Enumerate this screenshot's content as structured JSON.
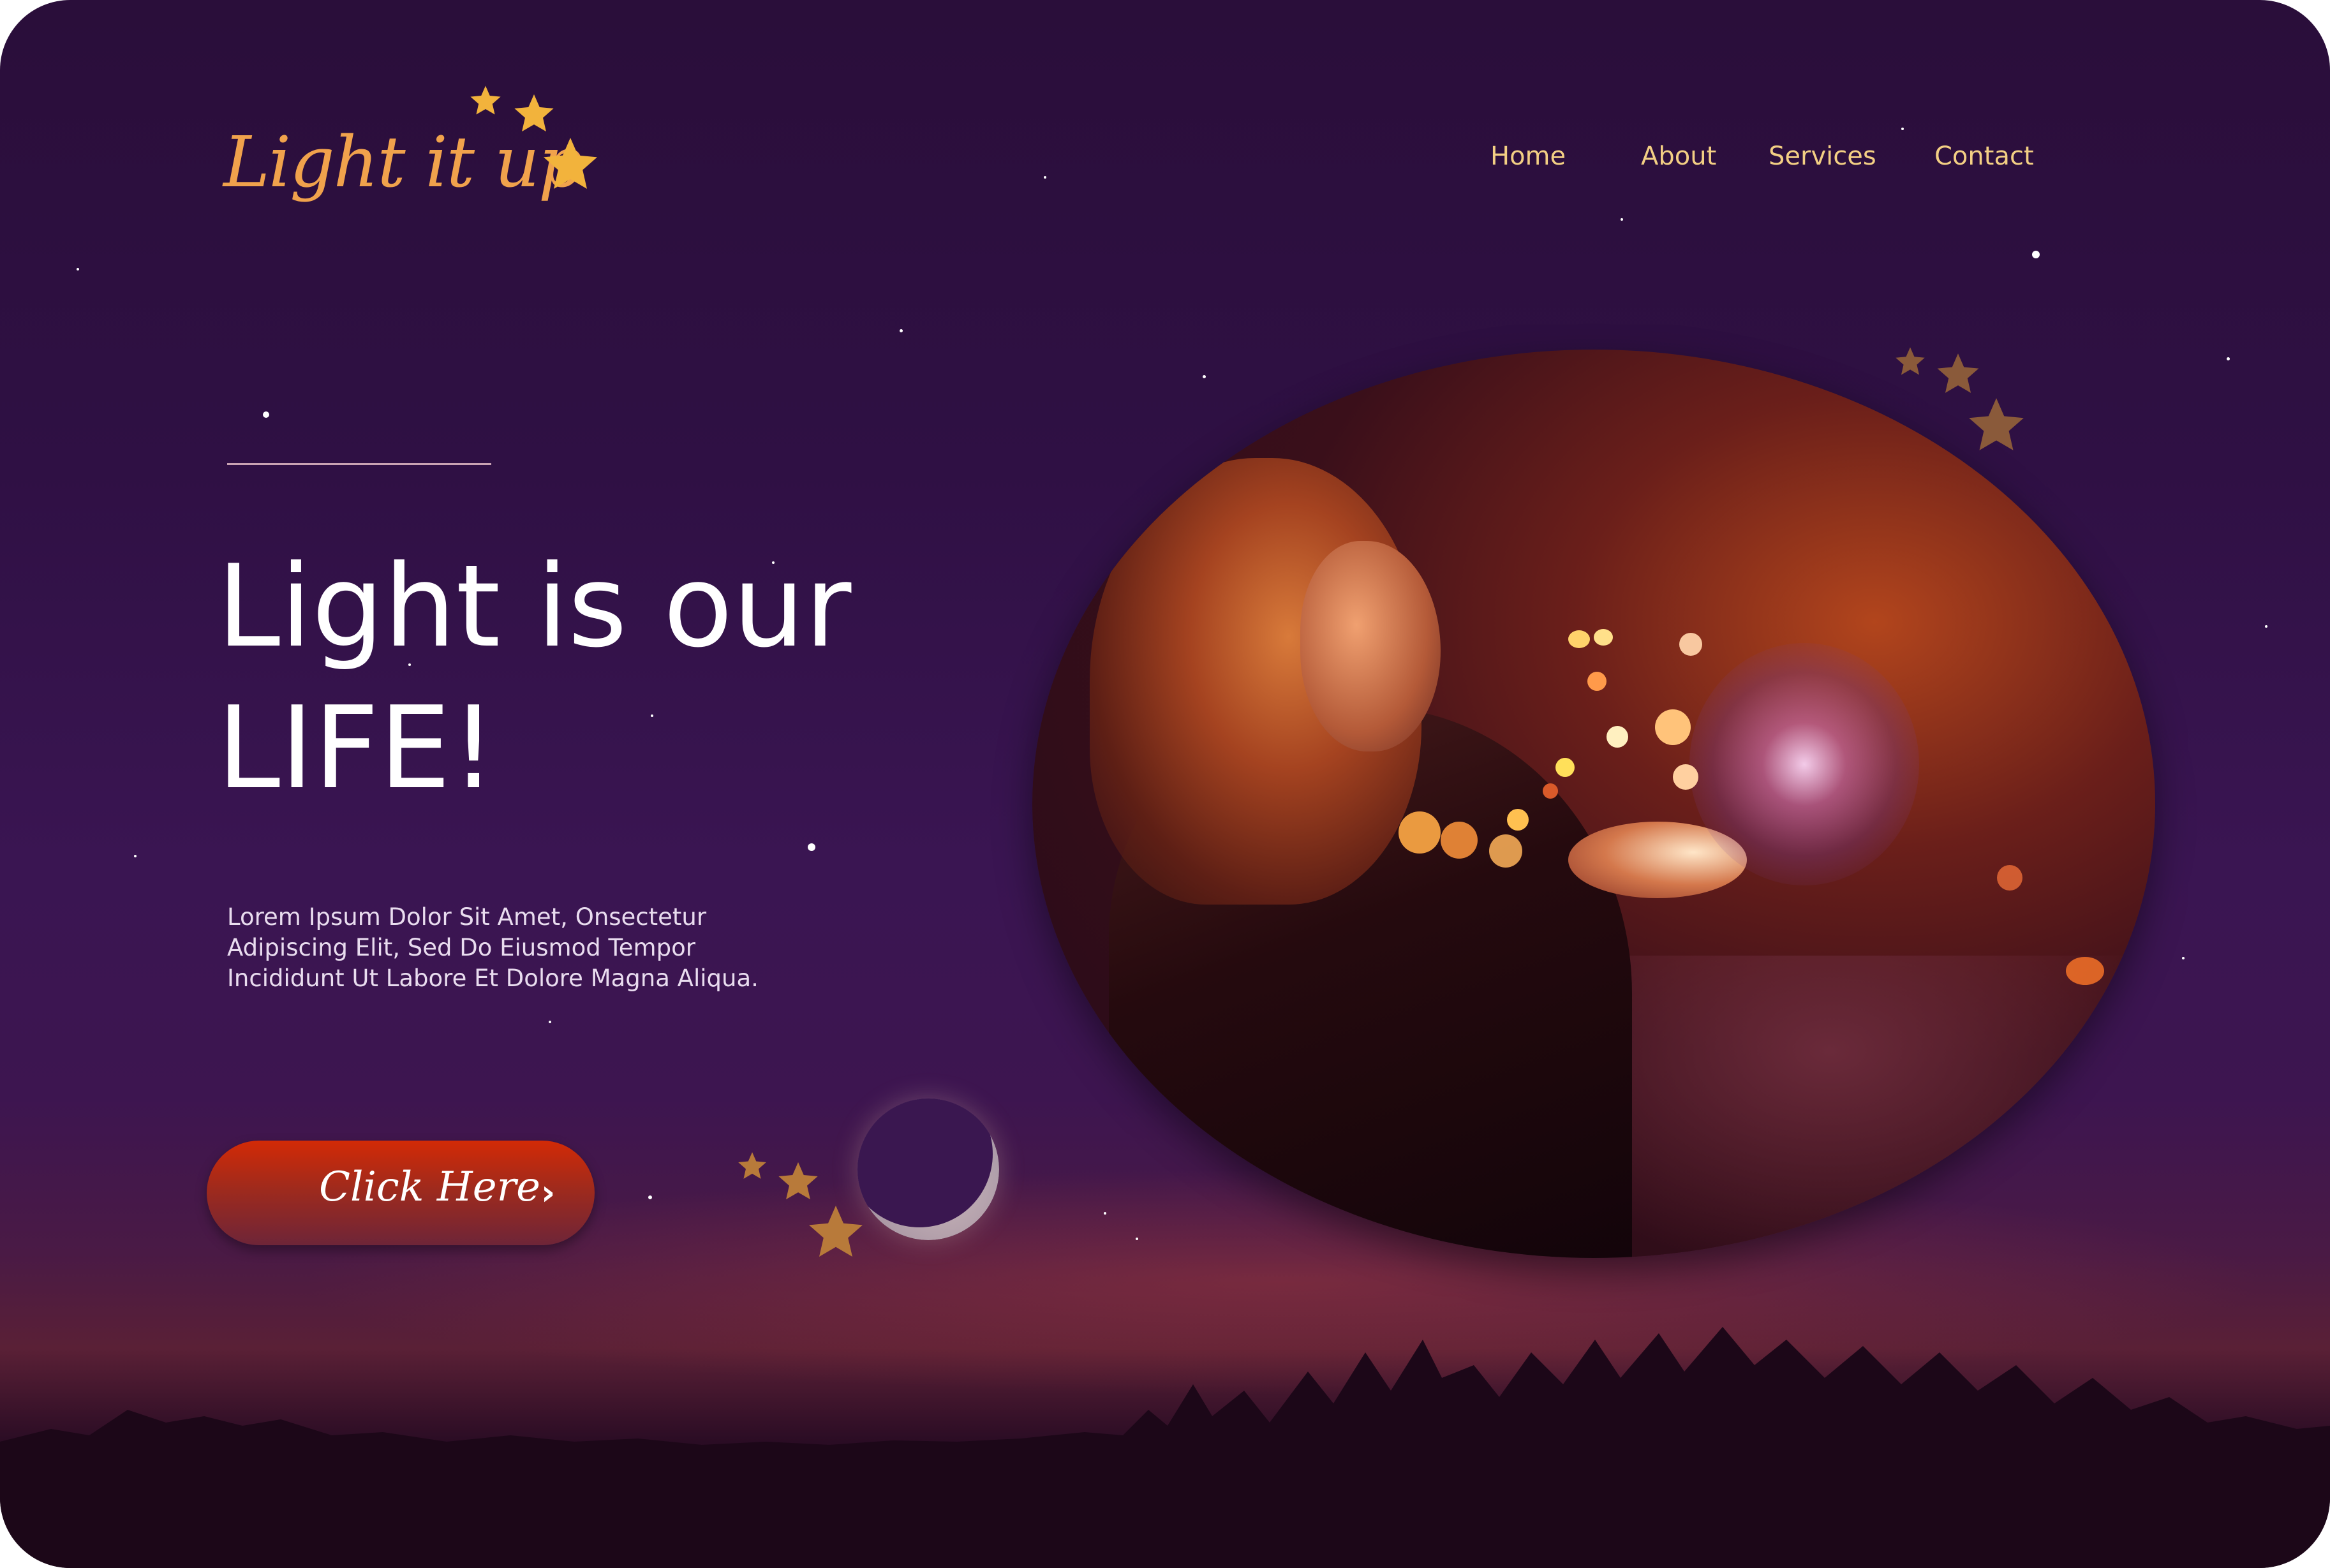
{
  "brand": {
    "logo_text": "Light it up"
  },
  "nav": {
    "items": [
      "Home",
      "About",
      "Services",
      "Contact"
    ]
  },
  "hero": {
    "headline_line1": "Light is our",
    "headline_line2": "LIFE!",
    "description_line1": "Lorem Ipsum Dolor Sit Amet,  Onsectetur",
    "description_line2": "Adipiscing Elit, Sed Do Eiusmod Tempor",
    "description_line3": "Incididunt Ut Labore Et Dolore Magna Aliqua.",
    "cta_label": "Click Here",
    "cta_icon": "chevron-right-icon"
  },
  "colors": {
    "background_top": "#2a0e3a",
    "background_mid": "#3a1552",
    "nav_text": "#f3cf84",
    "logo": "#f0a24c",
    "cta_top": "#d32a06",
    "cta_bottom": "#6e2538",
    "star_gold": "#f2b33c"
  }
}
